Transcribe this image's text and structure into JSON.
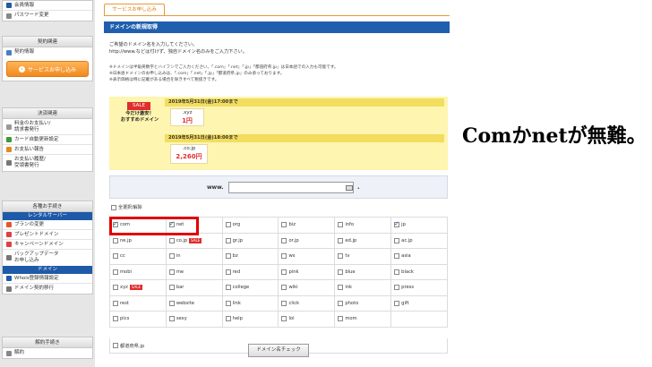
{
  "sidebar": {
    "top_items": [
      {
        "label": "会員情報",
        "icon": "person-icon",
        "color": "#1e5aa8"
      },
      {
        "label": "パスワード変更",
        "icon": "key-icon",
        "color": "#888888"
      }
    ],
    "contract": {
      "header": "契約関連",
      "items": [
        {
          "label": "契約情報",
          "icon": "document-icon",
          "color": "#4a7fc1"
        }
      ],
      "button_label": "サービスお申し込み"
    },
    "payment": {
      "header": "決済関連",
      "items": [
        {
          "label": "料金のお支払い/\n請求書発行",
          "icon": "invoice-icon",
          "color": "#999999"
        },
        {
          "label": "カード自動更新設定",
          "icon": "card-icon",
          "color": "#3a9a3a"
        },
        {
          "label": "お支払い報告",
          "icon": "mail-icon",
          "color": "#e58a1e"
        },
        {
          "label": "お支払い履歴/\n受領書発行",
          "icon": "clock-icon",
          "color": "#777777"
        }
      ]
    },
    "procedures": {
      "header": "各種お手続き",
      "rental_header": "レンタルサーバー",
      "rental_items": [
        {
          "label": "プランの変更",
          "icon": "refresh-icon",
          "color": "#e05a2a"
        },
        {
          "label": "プレゼントドメイン",
          "icon": "gift-icon",
          "color": "#e04040"
        },
        {
          "label": "キャンペーンドメイン",
          "icon": "megaphone-icon",
          "color": "#e04040"
        },
        {
          "label": "バックアップデータ\nお申し込み",
          "icon": "disk-icon",
          "color": "#777777"
        }
      ],
      "domain_header": "ドメイン",
      "domain_items": [
        {
          "label": "Whois登録情報設定",
          "icon": "globe-icon",
          "color": "#1e5aa8"
        },
        {
          "label": "ドメイン契約移行",
          "icon": "transfer-icon",
          "color": "#777777"
        }
      ]
    },
    "cancel": {
      "header": "解約手続き",
      "items": [
        {
          "label": "解約",
          "icon": "cancel-icon",
          "color": "#888888"
        }
      ]
    }
  },
  "main": {
    "tab_label": "サービスお申し込み",
    "panel_title": "ドメインの新規取得",
    "intro_lines": [
      "ご希望のドメイン名を入力してください。",
      "http://www.などは付けず、独自ドメイン名のみをご入力下さい。"
    ],
    "notes": [
      "※ドメインは半角英数字とハイフンでご入力ください。「.com」「.net」「.jp」「都道府県.jp」は日本語での入力も可能です。",
      "※日本語ドメインのお申し込みは、「.com」「.net」「.jp」「都道府県.jp」のみ承っております。",
      "※表示価格は特に記載がある場合を除きすべて税抜きです。"
    ],
    "promo": {
      "sale_label": "SALE",
      "left_lines": [
        "今だけ激安！",
        "おすすめドメイン"
      ],
      "bars": [
        {
          "label": "2019年5月31日(金)17:00まで",
          "tld": ".xyz",
          "price": "1円"
        },
        {
          "label": "2019年5月31日(金)18:00まで",
          "tld": ".co.jp",
          "price": "2,260円"
        }
      ]
    },
    "search": {
      "prefix": "www.",
      "value": "",
      "suffix": "."
    },
    "select_all_label": "全選択/解除",
    "tlds": [
      {
        "name": "com",
        "checked": true
      },
      {
        "name": "net",
        "checked": true
      },
      {
        "name": "org",
        "checked": false
      },
      {
        "name": "biz",
        "checked": false
      },
      {
        "name": "info",
        "checked": false
      },
      {
        "name": "jp",
        "checked": true
      },
      {
        "name": "ne.jp",
        "checked": false
      },
      {
        "name": "co.jp",
        "checked": false,
        "sale": "SALE"
      },
      {
        "name": "gr.jp",
        "checked": false
      },
      {
        "name": "or.jp",
        "checked": false
      },
      {
        "name": "ed.jp",
        "checked": false
      },
      {
        "name": "ac.jp",
        "checked": false
      },
      {
        "name": "cc",
        "checked": false
      },
      {
        "name": "in",
        "checked": false
      },
      {
        "name": "bz",
        "checked": false
      },
      {
        "name": "ws",
        "checked": false
      },
      {
        "name": "tv",
        "checked": false
      },
      {
        "name": "asia",
        "checked": false
      },
      {
        "name": "mobi",
        "checked": false
      },
      {
        "name": "me",
        "checked": false
      },
      {
        "name": "red",
        "checked": false
      },
      {
        "name": "pink",
        "checked": false
      },
      {
        "name": "blue",
        "checked": false
      },
      {
        "name": "black",
        "checked": false
      },
      {
        "name": "xyz",
        "checked": false,
        "sale": "SALE"
      },
      {
        "name": "bar",
        "checked": false
      },
      {
        "name": "college",
        "checked": false
      },
      {
        "name": "wiki",
        "checked": false
      },
      {
        "name": "ink",
        "checked": false
      },
      {
        "name": "press",
        "checked": false
      },
      {
        "name": "rest",
        "checked": false
      },
      {
        "name": "website",
        "checked": false
      },
      {
        "name": "link",
        "checked": false
      },
      {
        "name": "click",
        "checked": false
      },
      {
        "name": "photo",
        "checked": false
      },
      {
        "name": "gift",
        "checked": false
      },
      {
        "name": "pics",
        "checked": false
      },
      {
        "name": "sexy",
        "checked": false
      },
      {
        "name": "help",
        "checked": false
      },
      {
        "name": "lol",
        "checked": false
      },
      {
        "name": "mom",
        "checked": false
      }
    ],
    "prefecture_label": "都道府県.jp",
    "check_button_label": "ドメイン名チェック"
  },
  "annotation": "Comかnetが無難。",
  "colors": {
    "brand_blue": "#1f5fae",
    "accent_orange": "#f08a1e",
    "sale_red": "#e02d2d",
    "highlight_red": "#e00000"
  }
}
